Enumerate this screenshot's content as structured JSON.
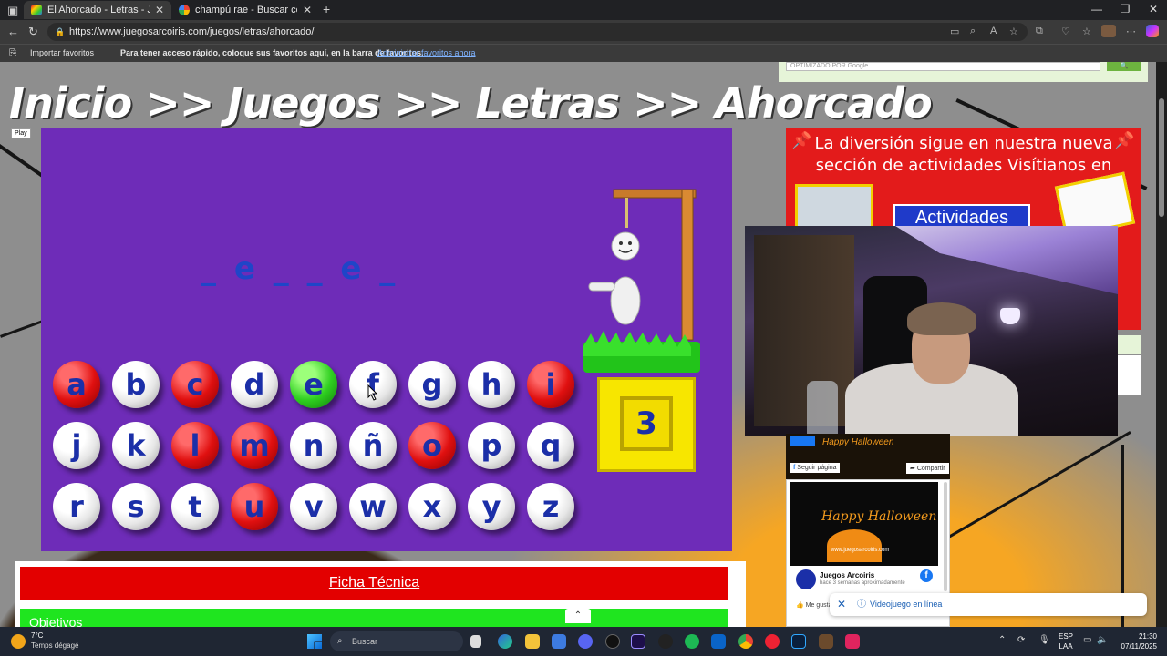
{
  "browser": {
    "tabs": [
      {
        "title": "El Ahorcado - Letras - Juegos - Ju",
        "active": true
      },
      {
        "title": "champú rae - Buscar con Google",
        "active": false
      }
    ],
    "new_tab_symbol": "+",
    "url": "https://www.juegosarcoiris.com/juegos/letras/ahorcado/",
    "import_favorites": "Importar favoritos",
    "favbar_message": "Para tener acceso rápido, coloque sus favoritos aquí, en la barra de favoritos.",
    "favbar_link": "Administrar favoritos ahora"
  },
  "page": {
    "search_hint": "OPTIMIZADO POR Google",
    "search_button_icon": "search-icon",
    "breadcrumb": "Inicio >> Juegos >> Letras >> Ahorcado",
    "play_badge": "Play",
    "game": {
      "word_display": "_ e _ _ e _",
      "attempts_left": "3",
      "letters": [
        {
          "ch": "a",
          "state": "red"
        },
        {
          "ch": "b",
          "state": "white"
        },
        {
          "ch": "c",
          "state": "red"
        },
        {
          "ch": "d",
          "state": "white"
        },
        {
          "ch": "e",
          "state": "green"
        },
        {
          "ch": "f",
          "state": "white"
        },
        {
          "ch": "g",
          "state": "white"
        },
        {
          "ch": "h",
          "state": "white"
        },
        {
          "ch": "i",
          "state": "red"
        },
        {
          "ch": "j",
          "state": "white"
        },
        {
          "ch": "k",
          "state": "white"
        },
        {
          "ch": "l",
          "state": "red"
        },
        {
          "ch": "m",
          "state": "red"
        },
        {
          "ch": "n",
          "state": "white"
        },
        {
          "ch": "ñ",
          "state": "white"
        },
        {
          "ch": "o",
          "state": "red"
        },
        {
          "ch": "p",
          "state": "white"
        },
        {
          "ch": "q",
          "state": "white"
        },
        {
          "ch": "r",
          "state": "white"
        },
        {
          "ch": "s",
          "state": "white"
        },
        {
          "ch": "t",
          "state": "white"
        },
        {
          "ch": "u",
          "state": "red"
        },
        {
          "ch": "v",
          "state": "white"
        },
        {
          "ch": "w",
          "state": "white"
        },
        {
          "ch": "x",
          "state": "white"
        },
        {
          "ch": "y",
          "state": "white"
        },
        {
          "ch": "z",
          "state": "white"
        }
      ]
    },
    "ad": {
      "text": "La diversión sigue en nuestra nueva sección de actividades Visítianos en",
      "button": "Actividades"
    },
    "facebook": {
      "cover_text": "Happy Halloween",
      "follow": "Seguir página",
      "share": "Compartir",
      "post_image_title": "Happy Halloween",
      "post_image_sub": "www.juegosarcoiris.com",
      "page_name": "Juegos Arcoiris",
      "post_time": "hace 3 semanas aproximadamente",
      "like": "Me gusta",
      "logo_letter": "f"
    },
    "toast": "Videojuego en línea",
    "ficha": "Ficha Técnica",
    "objetivos": "Objetivos"
  },
  "taskbar": {
    "temp": "7°C",
    "weather": "Temps dégagé",
    "search": "Buscar",
    "lang_1": "ESP",
    "lang_2": "LAA",
    "time": "21:30",
    "date": "07/11/2025"
  },
  "colors": {
    "game_bg": "#6e2cb8",
    "ad_bg": "#e31b1b",
    "ficha_bg": "#e30000",
    "objetivos_bg": "#1fe51f"
  }
}
